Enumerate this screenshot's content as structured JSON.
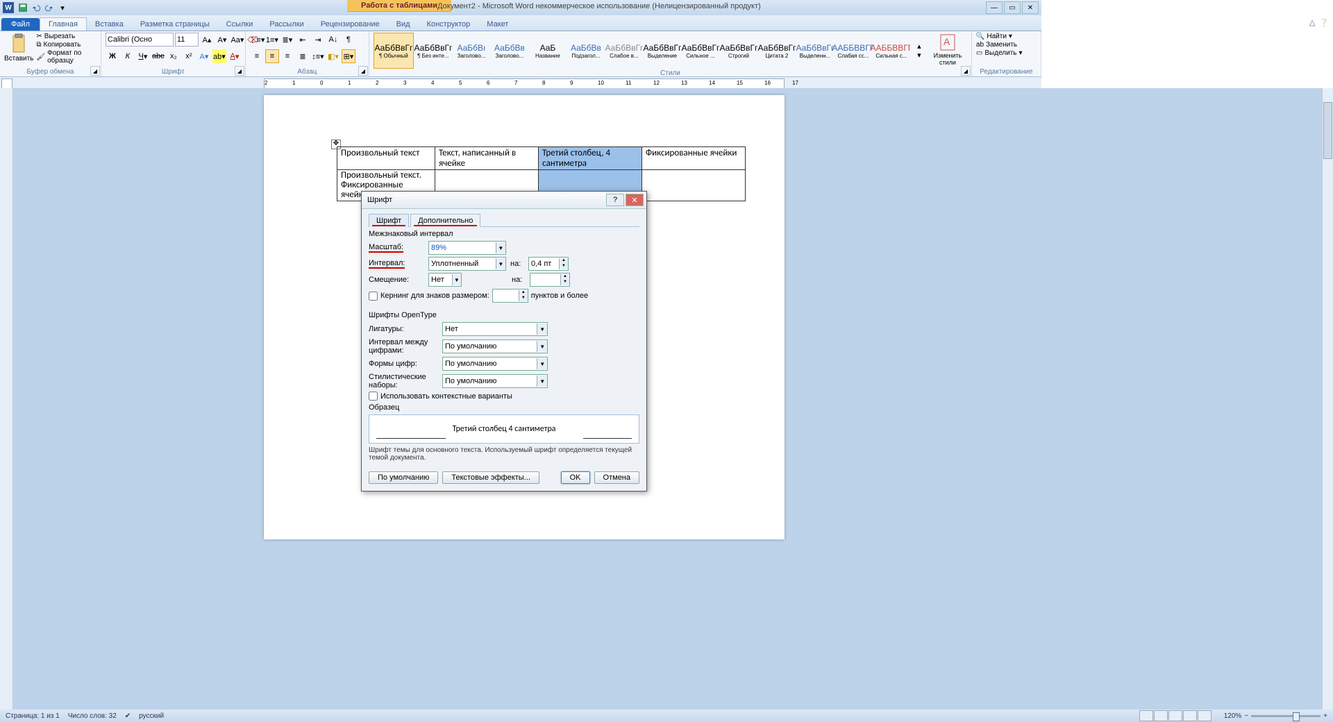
{
  "titlebar": {
    "table_tools": "Работа с таблицами",
    "doc_title": "Документ2 - Microsoft Word некоммерческое использование (Нелицензированный продукт)"
  },
  "tabs": {
    "file": "Файл",
    "home": "Главная",
    "insert": "Вставка",
    "pagelayout": "Разметка страницы",
    "references": "Ссылки",
    "mailings": "Рассылки",
    "review": "Рецензирование",
    "view": "Вид",
    "design": "Конструктор",
    "layout": "Макет"
  },
  "ribbon": {
    "clipboard": {
      "label": "Буфер обмена",
      "paste": "Вставить",
      "cut": "Вырезать",
      "copy": "Копировать",
      "format_painter": "Формат по образцу"
    },
    "font": {
      "label": "Шрифт",
      "name": "Calibri (Осно",
      "size": "11"
    },
    "paragraph": {
      "label": "Абзац"
    },
    "styles": {
      "label": "Стили",
      "items": [
        {
          "sample": "АаБбВвГг",
          "name": "¶ Обычный"
        },
        {
          "sample": "АаБбВвГг",
          "name": "¶ Без инте..."
        },
        {
          "sample": "АаБбВı",
          "name": "Заголово..."
        },
        {
          "sample": "АаБбВв",
          "name": "Заголово..."
        },
        {
          "sample": "АаБ",
          "name": "Название"
        },
        {
          "sample": "АаБбВв",
          "name": "Подзагол..."
        },
        {
          "sample": "АаБбВвГг",
          "name": "Слабое в..."
        },
        {
          "sample": "АаБбВвГг",
          "name": "Выделение"
        },
        {
          "sample": "АаБбВвГг",
          "name": "Сильное ..."
        },
        {
          "sample": "АаБбВвГг",
          "name": "Строгий"
        },
        {
          "sample": "АаБбВвГг",
          "name": "Цитата 2"
        },
        {
          "sample": "АаБбВвГг",
          "name": "Выделенн..."
        },
        {
          "sample": "ААББВВГГ",
          "name": "Слабая сс..."
        },
        {
          "sample": "ААББВВГГ",
          "name": "Сильная с..."
        }
      ],
      "change": "Изменить стили"
    },
    "editing": {
      "label": "Редактирование",
      "find": "Найти",
      "replace": "Заменить",
      "select": "Выделить"
    }
  },
  "table": {
    "r1c1": "Произвольный текст",
    "r1c2": "Текст,  написанный  в ячейке",
    "r1c3": "Третий  столбец, 4 сантиметра",
    "r1c4": "Фиксированные ячейки",
    "r2c1": "Произвольный текст. Фиксированные ячейки",
    "r2c2": "",
    "r2c3": "",
    "r2c4": ""
  },
  "dialog": {
    "title": "Шрифт",
    "tab_font": "Шрифт",
    "tab_advanced": "Дополнительно",
    "section_spacing": "Межзнаковый интервал",
    "scale_label": "Масштаб:",
    "scale_value": "89%",
    "spacing_label": "Интервал:",
    "spacing_value": "Уплотненный",
    "by_label": "на:",
    "by_value": "0,4 пт",
    "position_label": "Смещение:",
    "position_value": "Нет",
    "by2_label": "на:",
    "by2_value": "",
    "kerning": "Кернинг для знаков размером:",
    "kerning_value": "",
    "kerning_suffix": "пунктов и более",
    "section_opentype": "Шрифты OpenType",
    "ligatures_label": "Лигатуры:",
    "ligatures_value": "Нет",
    "numspacing_label": "Интервал между цифрами:",
    "numspacing_value": "По умолчанию",
    "numforms_label": "Формы цифр:",
    "numforms_value": "По умолчанию",
    "stylistic_label": "Стилистические наборы:",
    "stylistic_value": "По умолчанию",
    "contextual": "Использовать контекстные варианты",
    "preview_label": "Образец",
    "preview_text": "Третий столбец 4 сантиметра",
    "note": "Шрифт темы для основного текста. Используемый шрифт определяется текущей темой документа.",
    "default_btn": "По умолчанию",
    "effects_btn": "Текстовые эффекты...",
    "ok": "OK",
    "cancel": "Отмена"
  },
  "status": {
    "page": "Страница: 1 из 1",
    "words": "Число слов: 32",
    "lang": "русский",
    "zoom": "120%"
  }
}
